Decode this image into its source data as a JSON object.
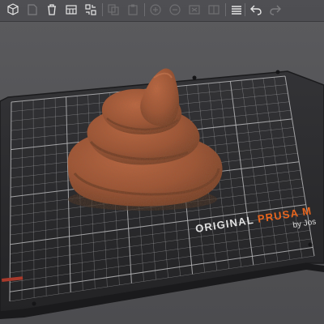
{
  "toolbar": {
    "buttons": [
      {
        "name": "add-object-button",
        "icon": "cube-add-icon",
        "enabled": true
      },
      {
        "name": "delete-button",
        "icon": "trash-icon",
        "enabled": true
      },
      {
        "name": "delete-all-button",
        "icon": "delete-all-icon",
        "enabled": true
      },
      {
        "name": "arrange-button",
        "icon": "arrange-icon",
        "enabled": true
      },
      {
        "name": "copy-button",
        "icon": "copy-icon",
        "enabled": false
      },
      {
        "name": "paste-button",
        "icon": "paste-icon",
        "enabled": false
      },
      {
        "name": "add-instance-button",
        "icon": "plus-circle-icon",
        "enabled": false
      },
      {
        "name": "remove-instance-button",
        "icon": "minus-circle-icon",
        "enabled": false
      },
      {
        "name": "split-objects-button",
        "icon": "split-objects-icon",
        "enabled": false
      },
      {
        "name": "split-parts-button",
        "icon": "split-parts-icon",
        "enabled": false
      },
      {
        "name": "layers-button",
        "icon": "layers-icon",
        "enabled": true
      },
      {
        "name": "undo-button",
        "icon": "undo-icon",
        "enabled": true
      },
      {
        "name": "redo-button",
        "icon": "redo-icon",
        "enabled": false
      }
    ]
  },
  "bed": {
    "brand_prefix": "ORIGINAL ",
    "brand_name": "PRUSA M",
    "brand_sub": "by Jos",
    "brand_color": "#e8651e",
    "surface_color": "#2a2a2c",
    "grid_color": "#b9b9bb"
  },
  "model": {
    "color": "#a35433"
  }
}
